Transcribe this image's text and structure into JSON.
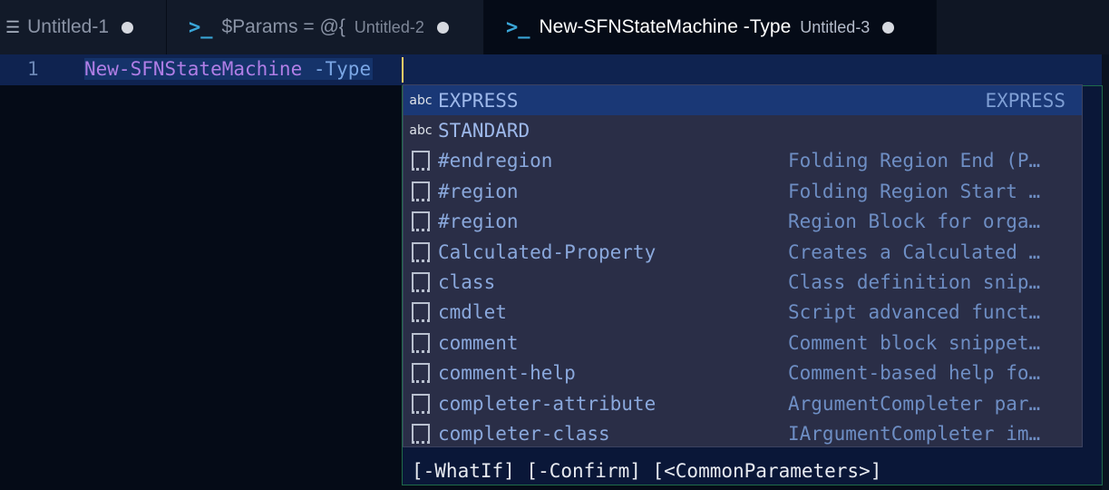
{
  "tabs": [
    {
      "title": "Untitled-1",
      "description": "",
      "icon": "lines-icon",
      "active": false
    },
    {
      "title": "$Params = @{",
      "description": "Untitled-2",
      "icon": "powershell-icon",
      "active": false
    },
    {
      "title": "New-SFNStateMachine -Type",
      "description": "Untitled-3",
      "icon": "powershell-icon",
      "active": true
    }
  ],
  "editor": {
    "line_number": "1",
    "command": "New-SFNStateMachine",
    "parameter": "-Type"
  },
  "suggestions": [
    {
      "kind": "abc",
      "label": "EXPRESS",
      "detail": "EXPRESS",
      "selected": true
    },
    {
      "kind": "abc",
      "label": "STANDARD",
      "detail": ""
    },
    {
      "kind": "snippet",
      "label": "#endregion",
      "detail": "Folding Region End (P…"
    },
    {
      "kind": "snippet",
      "label": "#region",
      "detail": "Folding Region Start …"
    },
    {
      "kind": "snippet",
      "label": "#region",
      "detail": "Region Block for orga…"
    },
    {
      "kind": "snippet",
      "label": "Calculated-Property",
      "detail": "Creates a Calculated …"
    },
    {
      "kind": "snippet",
      "label": "class",
      "detail": "Class definition snip…"
    },
    {
      "kind": "snippet",
      "label": "cmdlet",
      "detail": "Script advanced funct…"
    },
    {
      "kind": "snippet",
      "label": "comment",
      "detail": "Comment block snippet…"
    },
    {
      "kind": "snippet",
      "label": "comment-help",
      "detail": "Comment-based help fo…"
    },
    {
      "kind": "snippet",
      "label": "completer-attribute",
      "detail": "ArgumentCompleter par…"
    },
    {
      "kind": "snippet",
      "label": "completer-class",
      "detail": "IArgumentCompleter im…"
    }
  ],
  "signature_help": {
    "text": "[-WhatIf] [-Confirm] [<CommonParameters>]"
  },
  "colors": {
    "accent": "#3aa6d8",
    "selection": "#1a3876",
    "caret": "#ffcc66"
  }
}
